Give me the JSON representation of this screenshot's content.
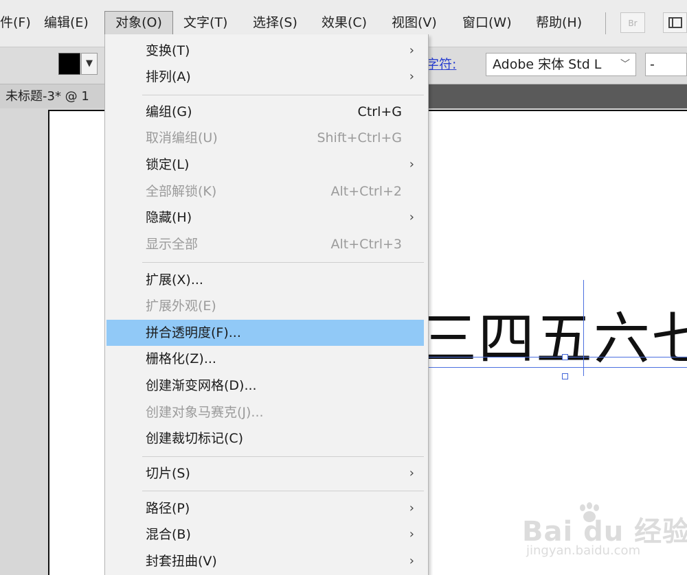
{
  "menubar": {
    "items": [
      {
        "label": "件(F)",
        "active": false
      },
      {
        "label": "编辑(E)",
        "active": false
      },
      {
        "label": "对象(O)",
        "active": true
      },
      {
        "label": "文字(T)",
        "active": false
      },
      {
        "label": "选择(S)",
        "active": false
      },
      {
        "label": "效果(C)",
        "active": false
      },
      {
        "label": "视图(V)",
        "active": false
      },
      {
        "label": "窗口(W)",
        "active": false
      },
      {
        "label": "帮助(H)",
        "active": false
      }
    ],
    "bridge_label": "Br"
  },
  "controlbar": {
    "fill_color": "#000000",
    "char_label": "字符:",
    "font_family": "Adobe 宋体 Std L",
    "font_style": "-"
  },
  "document": {
    "tab_title": "未标题-3* @ 1",
    "artboard_text": "三四五六七"
  },
  "object_menu": {
    "items": [
      {
        "label": "变换(T)",
        "shortcut": "",
        "submenu": true,
        "disabled": false
      },
      {
        "label": "排列(A)",
        "shortcut": "",
        "submenu": true,
        "disabled": false
      },
      {
        "label": "编组(G)",
        "shortcut": "Ctrl+G",
        "submenu": false,
        "disabled": false
      },
      {
        "label": "取消编组(U)",
        "shortcut": "Shift+Ctrl+G",
        "submenu": false,
        "disabled": true
      },
      {
        "label": "锁定(L)",
        "shortcut": "",
        "submenu": true,
        "disabled": false
      },
      {
        "label": "全部解锁(K)",
        "shortcut": "Alt+Ctrl+2",
        "submenu": false,
        "disabled": true
      },
      {
        "label": "隐藏(H)",
        "shortcut": "",
        "submenu": true,
        "disabled": false
      },
      {
        "label": "显示全部",
        "shortcut": "Alt+Ctrl+3",
        "submenu": false,
        "disabled": true
      },
      {
        "label": "扩展(X)...",
        "shortcut": "",
        "submenu": false,
        "disabled": false
      },
      {
        "label": "扩展外观(E)",
        "shortcut": "",
        "submenu": false,
        "disabled": true
      },
      {
        "label": "拼合透明度(F)...",
        "shortcut": "",
        "submenu": false,
        "disabled": false,
        "highlighted": true
      },
      {
        "label": "栅格化(Z)...",
        "shortcut": "",
        "submenu": false,
        "disabled": false
      },
      {
        "label": "创建渐变网格(D)...",
        "shortcut": "",
        "submenu": false,
        "disabled": false
      },
      {
        "label": "创建对象马赛克(J)...",
        "shortcut": "",
        "submenu": false,
        "disabled": true
      },
      {
        "label": "创建裁切标记(C)",
        "shortcut": "",
        "submenu": false,
        "disabled": false
      },
      {
        "label": "切片(S)",
        "shortcut": "",
        "submenu": true,
        "disabled": false
      },
      {
        "label": "路径(P)",
        "shortcut": "",
        "submenu": true,
        "disabled": false
      },
      {
        "label": "混合(B)",
        "shortcut": "",
        "submenu": true,
        "disabled": false
      },
      {
        "label": "封套扭曲(V)",
        "shortcut": "",
        "submenu": true,
        "disabled": false
      }
    ],
    "submenu_arrow": "›",
    "highlight_color": "#91c9f7"
  },
  "watermark": {
    "brand": "Bai du 经验",
    "url": "jingyan.baidu.com"
  }
}
